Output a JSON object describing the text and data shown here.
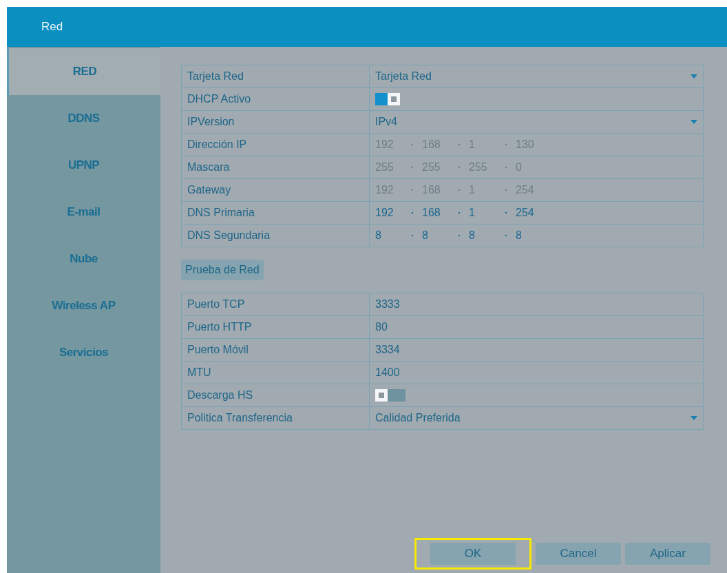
{
  "window": {
    "title": "Red"
  },
  "sidebar": {
    "items": [
      {
        "label": "RED",
        "selected": true
      },
      {
        "label": "DDNS",
        "selected": false
      },
      {
        "label": "UPNP",
        "selected": false
      },
      {
        "label": "E-mail",
        "selected": false
      },
      {
        "label": "Nube",
        "selected": false
      },
      {
        "label": "Wireless AP",
        "selected": false
      },
      {
        "label": "Servicios",
        "selected": false
      }
    ]
  },
  "network_table": {
    "rows": [
      {
        "label": "Tarjeta Red",
        "kind": "dropdown",
        "value": "Tarjeta Red"
      },
      {
        "label": "DHCP Activo",
        "kind": "toggle",
        "on": true
      },
      {
        "label": "IPVersion",
        "kind": "dropdown",
        "value": "IPv4"
      },
      {
        "label": "Dirección IP",
        "kind": "ip",
        "disabled": true,
        "octets": [
          "192",
          "168",
          "1",
          "130"
        ]
      },
      {
        "label": "Mascara",
        "kind": "ip",
        "disabled": true,
        "octets": [
          "255",
          "255",
          "255",
          "0"
        ]
      },
      {
        "label": "Gateway",
        "kind": "ip",
        "disabled": true,
        "octets": [
          "192",
          "168",
          "1",
          "254"
        ]
      },
      {
        "label": "DNS Primaria",
        "kind": "ip",
        "disabled": false,
        "octets": [
          "192",
          "168",
          "1",
          "254"
        ]
      },
      {
        "label": "DNS Segundaria",
        "kind": "ip",
        "disabled": false,
        "octets": [
          "8",
          "8",
          "8",
          "8"
        ]
      }
    ]
  },
  "test_button": {
    "label": "Prueba de Red"
  },
  "ports_table": {
    "rows": [
      {
        "label": "Puerto TCP",
        "kind": "text",
        "value": "3333"
      },
      {
        "label": "Puerto HTTP",
        "kind": "text",
        "value": "80"
      },
      {
        "label": "Puerto Móvil",
        "kind": "text",
        "value": "3334"
      },
      {
        "label": "MTU",
        "kind": "text",
        "value": "1400"
      },
      {
        "label": "Descarga HS",
        "kind": "toggle",
        "on": false
      },
      {
        "label": "Politica Transferencia",
        "kind": "dropdown",
        "value": "Calidad Preferida"
      }
    ]
  },
  "buttons": [
    {
      "label": "OK",
      "highlighted": true
    },
    {
      "label": "Cancel",
      "highlighted": false
    },
    {
      "label": "Aplicar",
      "highlighted": false
    }
  ]
}
